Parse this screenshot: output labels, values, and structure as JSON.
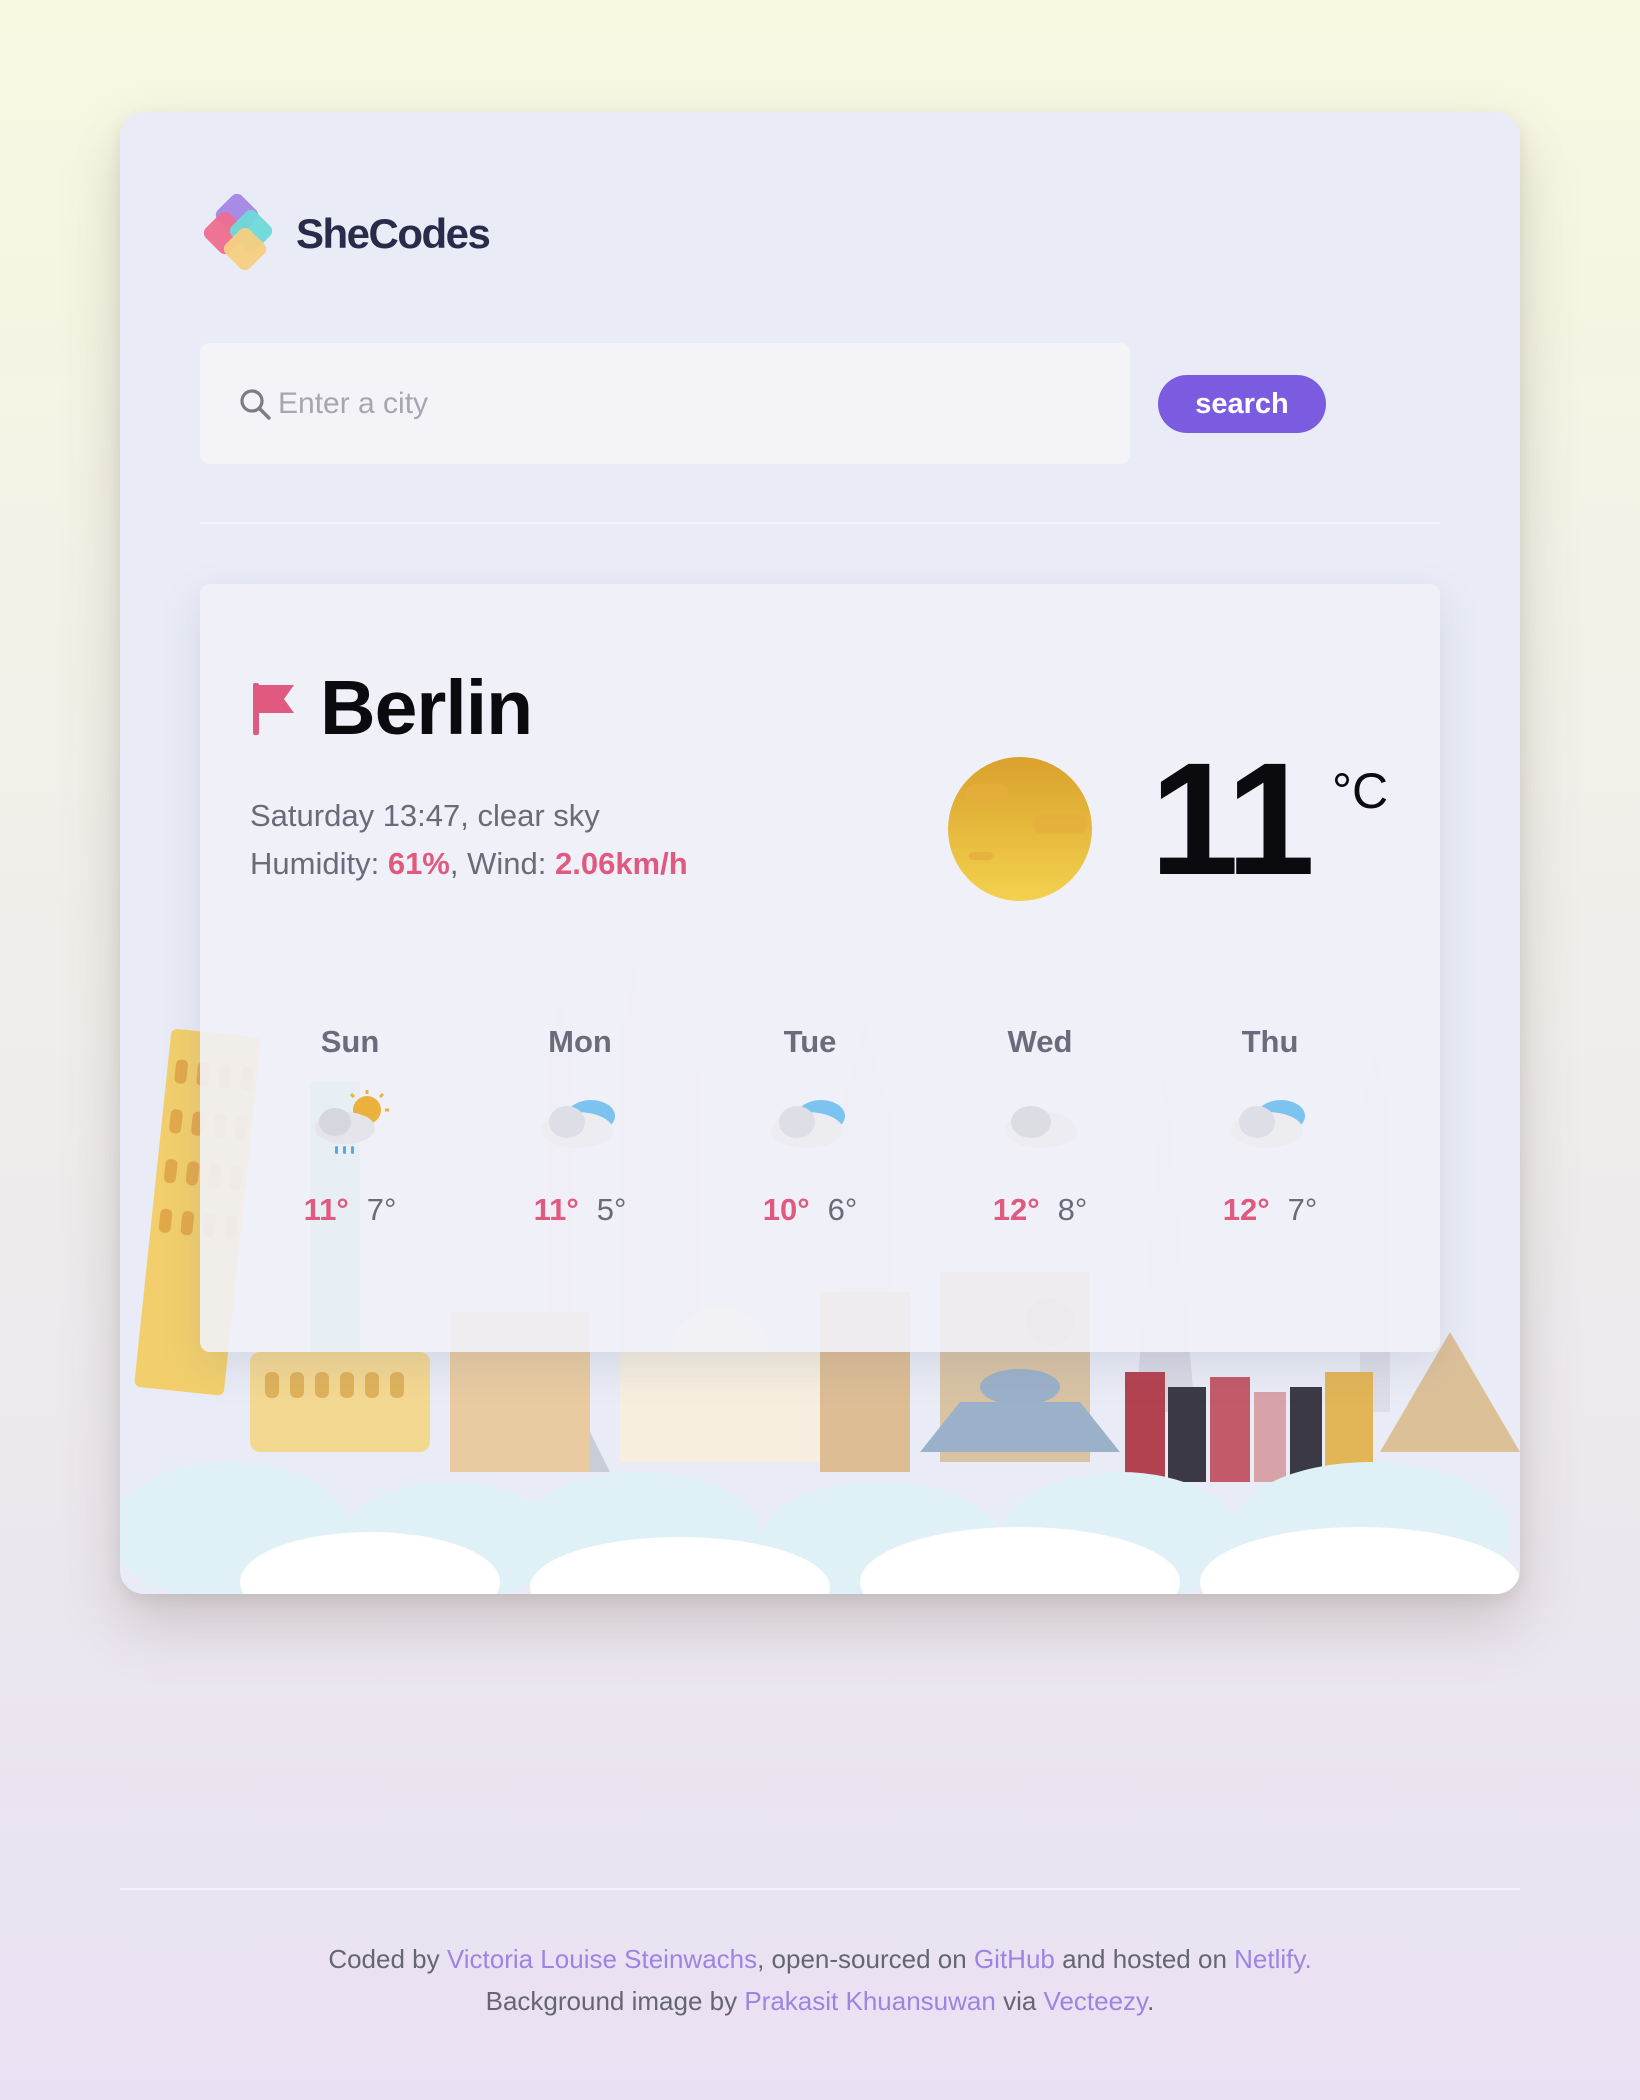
{
  "brand": {
    "name": "SheCodes"
  },
  "search": {
    "placeholder": "Enter a city",
    "value": "",
    "button_label": "search"
  },
  "current": {
    "city": "Berlin",
    "day_time": "Saturday 13:47",
    "description": "clear sky",
    "humidity_label": "Humidity:",
    "humidity": "61%",
    "wind_label": "Wind:",
    "wind": "2.06km/h",
    "temperature": "11",
    "unit": "°C",
    "icon": "clear-sky-sun-icon"
  },
  "forecast": [
    {
      "day": "Sun",
      "max": "11°",
      "min": "7°",
      "icon": "rain-sun-cloud-icon"
    },
    {
      "day": "Mon",
      "max": "11°",
      "min": "5°",
      "icon": "cloud-icon"
    },
    {
      "day": "Tue",
      "max": "10°",
      "min": "6°",
      "icon": "cloud-icon"
    },
    {
      "day": "Wed",
      "max": "12°",
      "min": "8°",
      "icon": "grey-cloud-icon"
    },
    {
      "day": "Thu",
      "max": "12°",
      "min": "7°",
      "icon": "cloud-icon"
    }
  ],
  "footer": {
    "coded_by": "Coded by",
    "author": "Victoria Louise Steinwachs",
    "open_sourced": ", open-sourced on",
    "github": "GitHub",
    "hosted": "and hosted on",
    "netlify": "Netlify.",
    "bg_by": "Background image by",
    "photographer": "Prakasit Khuansuwan",
    "via": "via",
    "vecteezy": "Vecteezy",
    "period": "."
  },
  "colors": {
    "accent": "#7b5ce1",
    "highlight": "#e0597f",
    "link": "#9b84e2"
  }
}
